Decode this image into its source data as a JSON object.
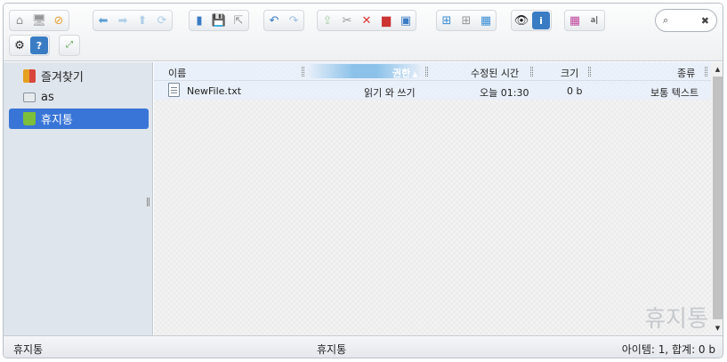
{
  "toolbar": {
    "row1_groups": [
      [
        "home-icon",
        "network-drive-icon",
        "disabled-icon"
      ],
      [
        "back-arrow-icon",
        "forward-arrow-icon",
        "up-arrow-icon",
        "reload-icon"
      ],
      [
        "open-icon",
        "save-icon",
        "select-icon"
      ],
      [
        "undo-icon",
        "redo-icon"
      ],
      [
        "upload-icon",
        "cut-icon",
        "delete-icon",
        "trash-icon",
        "resize-icon"
      ],
      [
        "view-large-icon",
        "view-grid-icon",
        "view-list-icon"
      ],
      [
        "preview-eye-icon",
        "info-icon"
      ],
      [
        "grid-view-icon",
        "rename-icon"
      ]
    ],
    "row2_groups": [
      [
        "settings-gear-icon",
        "help-icon"
      ],
      [
        "fullscreen-icon"
      ]
    ]
  },
  "search": {
    "placeholder": "",
    "value": ""
  },
  "sidebar": {
    "items": [
      {
        "label": "즐겨찾기",
        "icon": "favorites-icon",
        "color": "#e6a01f"
      },
      {
        "label": "as",
        "icon": "drive-icon",
        "color": "#9aa3ad"
      },
      {
        "label": "휴지통",
        "icon": "trash-bin-icon",
        "color": "#7cbf3a"
      }
    ],
    "active_index": 2
  },
  "table": {
    "columns": {
      "name": "이름",
      "permission": "권한",
      "modified": "수정된 시간",
      "size": "크기",
      "kind": "종류"
    },
    "rows": [
      {
        "name": "NewFile.txt",
        "permission": "읽기 와 쓰기",
        "modified": "오늘 01:30",
        "size": "0 b",
        "kind": "보통 텍스트"
      }
    ]
  },
  "watermark": "휴지통",
  "status": {
    "left": "휴지통",
    "center": "휴지통",
    "right": "아이템: 1, 합계: 0 b"
  },
  "colors": {
    "accent": "#3875d7",
    "sidebar_bg": "#dfe5ec"
  }
}
